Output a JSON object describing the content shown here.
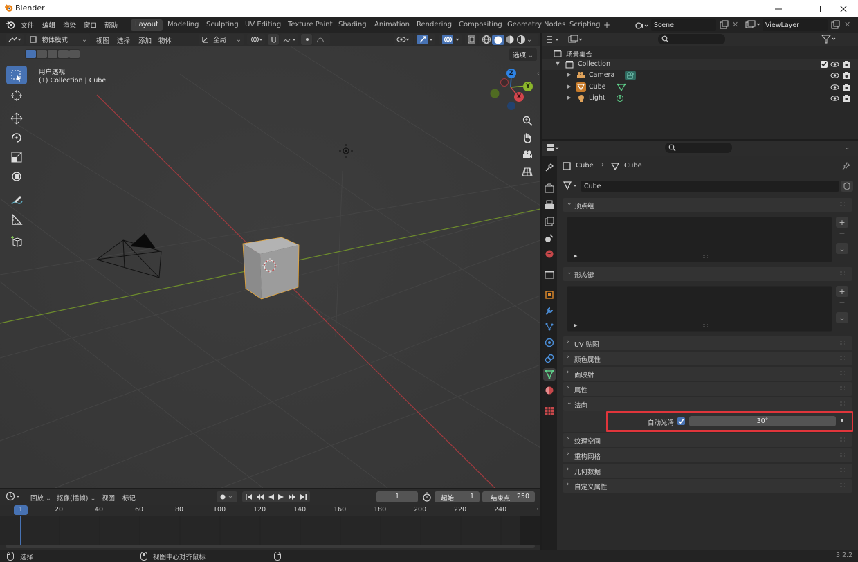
{
  "window": {
    "title": "Blender",
    "version": "3.2.2"
  },
  "menu": {
    "items": [
      "文件",
      "编辑",
      "渲染",
      "窗口",
      "帮助"
    ]
  },
  "workspaces": {
    "tabs": [
      "Layout",
      "Modeling",
      "Sculpting",
      "UV Editing",
      "Texture Paint",
      "Shading",
      "Animation",
      "Rendering",
      "Compositing",
      "Geometry Nodes",
      "Scripting"
    ],
    "active": "Layout"
  },
  "scene": {
    "name": "Scene"
  },
  "view_layer": {
    "name": "ViewLayer"
  },
  "viewport": {
    "mode": "物体模式",
    "menus": [
      "视图",
      "选择",
      "添加",
      "物体"
    ],
    "transform_orientation": "全局",
    "options_label": "选项",
    "view_name": "用户透视",
    "view_context": "(1) Collection | Cube",
    "gizmo": {
      "z": "Z",
      "y": "Y",
      "x": "X"
    }
  },
  "outliner": {
    "root": "场景集合",
    "collection": "Collection",
    "items": [
      "Camera",
      "Cube",
      "Light"
    ]
  },
  "properties": {
    "breadcrumb_object": "Cube",
    "breadcrumb_data": "Cube",
    "mesh_name": "Cube",
    "panels": {
      "vertex_groups": "顶点组",
      "shape_keys": "形态键",
      "uv_maps": "UV 贴图",
      "color_attributes": "颜色属性",
      "face_maps": "面映射",
      "attributes": "属性",
      "normals": "法向",
      "texture_space": "纹理空间",
      "remesh": "重构网格",
      "geometry_data": "几何数据",
      "custom_properties": "自定义属性"
    },
    "auto_smooth_label": "自动光滑",
    "auto_smooth_enabled": true,
    "auto_smooth_angle": "30°",
    "highlight_color": "#e0353b"
  },
  "timeline": {
    "menus": [
      "回放",
      "抠像(插帧)",
      "视图",
      "标记"
    ],
    "current_frame": "1",
    "start_label": "起始",
    "start_value": "1",
    "end_label": "结束点",
    "end_value": "250",
    "ruler": [
      "20",
      "40",
      "60",
      "80",
      "100",
      "120",
      "140",
      "160",
      "180",
      "200",
      "220",
      "240"
    ],
    "playhead": "1"
  },
  "statusbar": {
    "select": "选择",
    "center": "视图中心对齐鼠标"
  },
  "colors": {
    "accent": "#4772b3",
    "x_axis": "#d2454c",
    "y_axis": "#8bb62b",
    "z_axis": "#2e83e4"
  }
}
